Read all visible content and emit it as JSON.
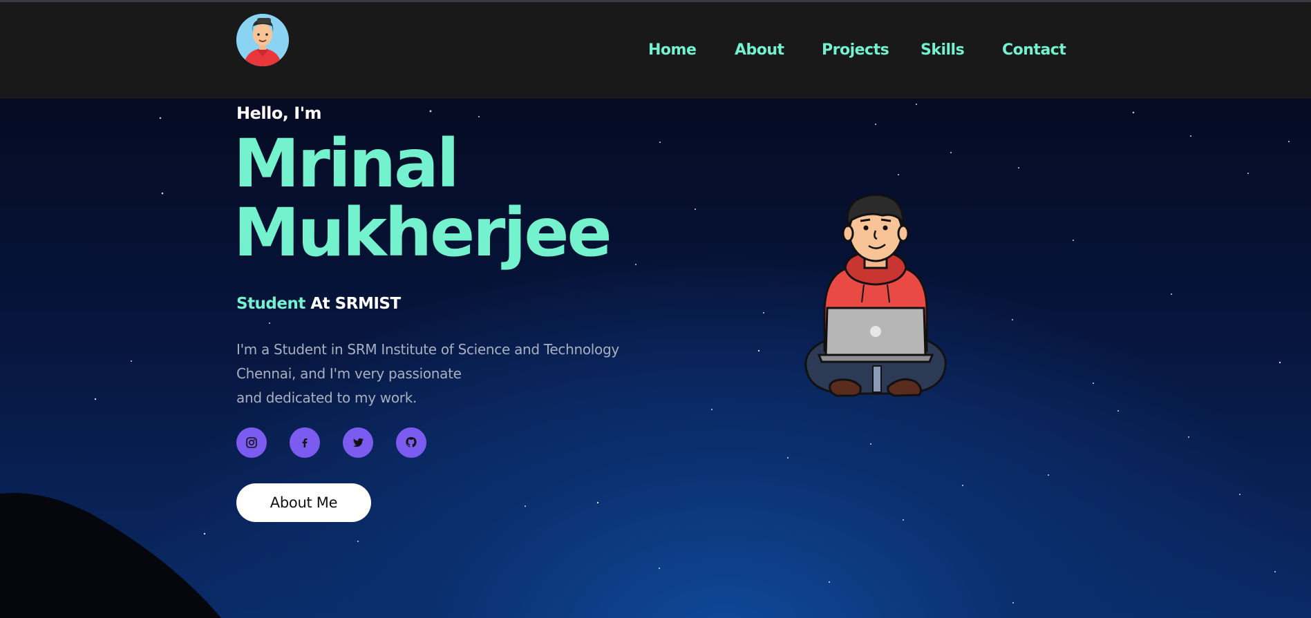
{
  "nav": {
    "links": [
      "Home",
      "About",
      "Projects",
      "Skills",
      "Contact"
    ]
  },
  "hero": {
    "greeting": "Hello, I'm",
    "name_first": "Mrinal",
    "name_last": "Mukherjee",
    "role_highlight": "Student",
    "role_rest": " At SRMIST",
    "bio_lines": [
      "I'm a Student in SRM Institute of Science and Technology",
      "Chennai, and I'm very passionate",
      "and dedicated to my work."
    ],
    "social_icons": [
      "instagram-icon",
      "facebook-icon",
      "twitter-icon",
      "github-icon"
    ],
    "button_label": "About Me"
  },
  "colors": {
    "accent": "#74f2ce",
    "social_bg": "#7c5cf0",
    "nav_bg": "#191919"
  }
}
